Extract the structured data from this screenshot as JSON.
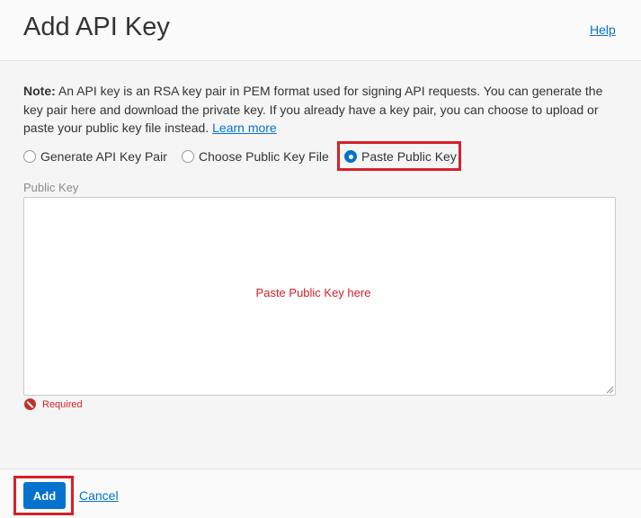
{
  "dialog": {
    "title": "Add API Key",
    "help_label": "Help"
  },
  "note": {
    "label": "Note:",
    "text": " An API key is an RSA key pair in PEM format used for signing API requests. You can generate the key pair here and download the private key. If you already have a key pair, you can choose to upload or paste your public key file instead. ",
    "learn_more_label": "Learn more"
  },
  "key_source": {
    "options": [
      {
        "label": "Generate API Key Pair",
        "selected": false
      },
      {
        "label": "Choose Public Key File",
        "selected": false
      },
      {
        "label": "Paste Public Key",
        "selected": true
      }
    ]
  },
  "public_key": {
    "label": "Public Key",
    "value": "",
    "hint_overlay": "Paste Public Key here",
    "validation_message": "Required"
  },
  "footer": {
    "add_label": "Add",
    "cancel_label": "Cancel"
  },
  "colors": {
    "accent": "#0572ce",
    "highlight": "#d6202a",
    "error": "#c2312c"
  }
}
